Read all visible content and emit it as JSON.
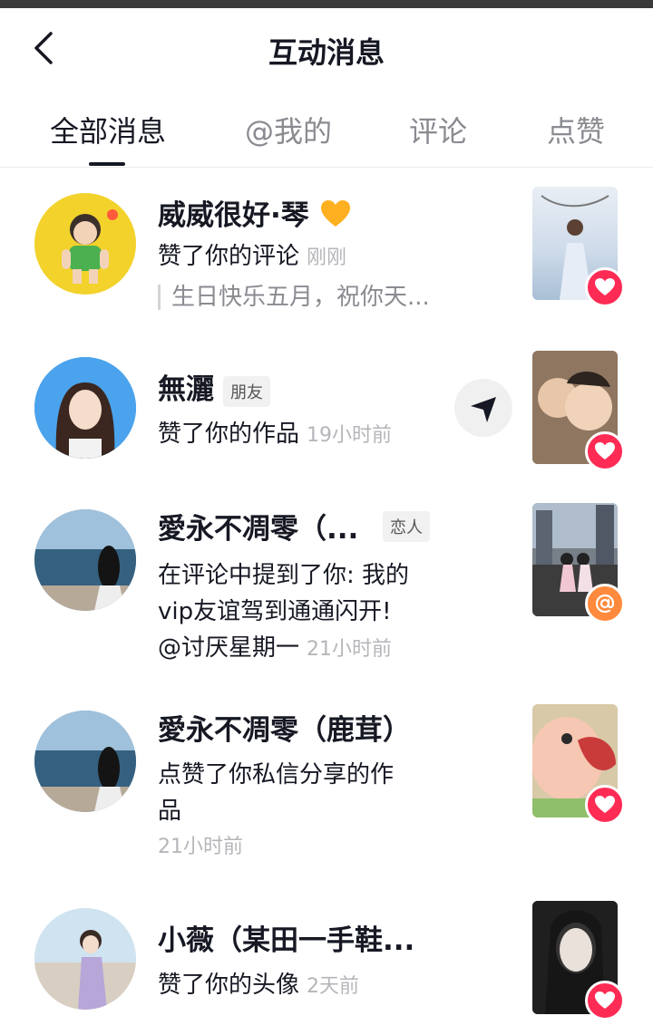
{
  "header": {
    "title": "互动消息"
  },
  "tabs": [
    {
      "label": "全部消息"
    },
    {
      "label": "@我的"
    },
    {
      "label": "评论"
    },
    {
      "label": "点赞"
    }
  ],
  "messages": [
    {
      "name": "威威很好·琴",
      "action": "赞了你的评论",
      "time": "刚刚",
      "quote": "生日快乐五月，祝你天..."
    },
    {
      "name": "無灑",
      "tag": "朋友",
      "action": "赞了你的作品",
      "time": "19小时前"
    },
    {
      "name": "愛永不凋零（...",
      "tag": "恋人",
      "line1": "在评论中提到了你: 我的",
      "line2": "vip友谊驾到通通闪开!",
      "line3": "@讨厌星期一",
      "time": "21小时前"
    },
    {
      "name": "愛永不凋零（鹿茸）",
      "line1": "点赞了你私信分享的作",
      "line2": "品",
      "time": "21小时前"
    },
    {
      "name": "小薇（某田一手鞋...",
      "action": "赞了你的头像",
      "time": "2天前"
    }
  ],
  "colors": {
    "like": "#fe2c55",
    "mention": "#ff8a3d",
    "muted": "#b5b6ba"
  }
}
